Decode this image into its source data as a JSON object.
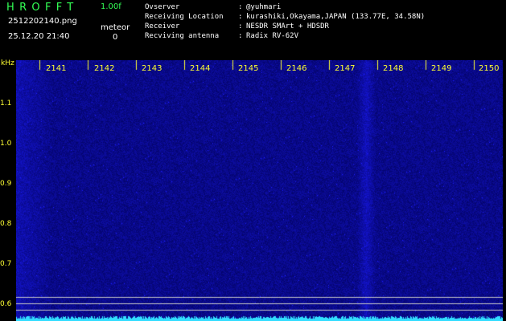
{
  "header": {
    "app_name": "HROFFT",
    "version": "1.00f",
    "filename": "2512202140.png",
    "datetime": "25.12.20 21:40",
    "meteor_label": "meteor",
    "meteor_count": "0",
    "info": [
      {
        "key": "Ovserver",
        "value": "@yuhmari"
      },
      {
        "key": "Receiving Location",
        "value": "kurashiki,Okayama,JAPAN (133.77E, 34.58N)"
      },
      {
        "key": "Receiver",
        "value": "NESDR SMArt + HDSDR"
      },
      {
        "key": "Recviving antenna",
        "value": "Radix RV-62V"
      }
    ],
    "separator": ":"
  },
  "axis": {
    "y_unit": "kHz",
    "y_ticks": [
      "1.1",
      "1.0",
      "0.9",
      "0.8",
      "0.7",
      "0.6"
    ],
    "x_ticks": [
      "2141",
      "2142",
      "2143",
      "2144",
      "2145",
      "2146",
      "2147",
      "2148",
      "2149",
      "2150"
    ]
  },
  "colors": {
    "background": "#000000",
    "label_green": "#33ff55",
    "axis_yellow": "#ffff33",
    "noise_blue": "#1a1aa0",
    "baseline_cyan": "#33ddff"
  }
}
